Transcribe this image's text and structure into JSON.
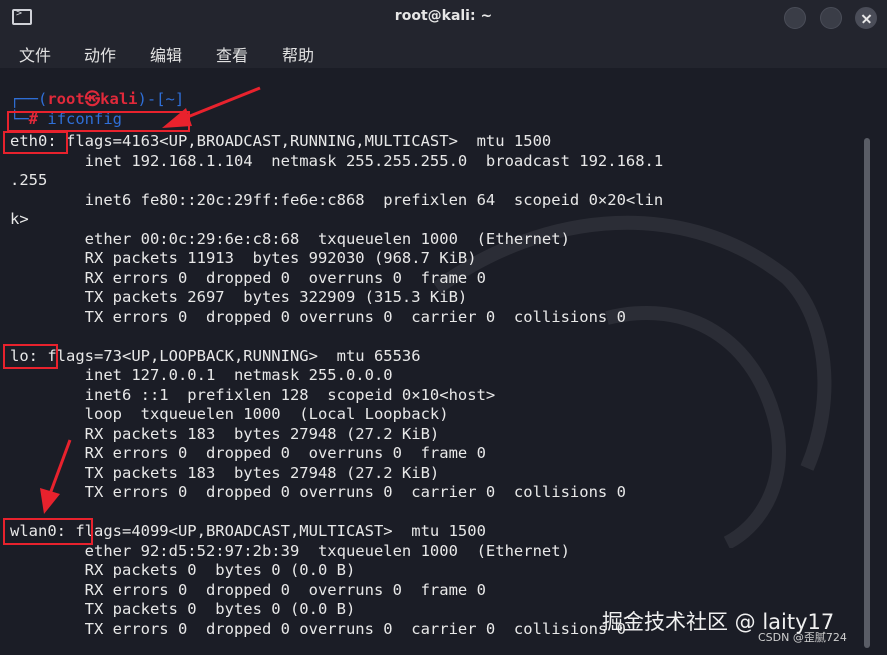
{
  "window": {
    "title": "root@kali: ~"
  },
  "menu": [
    "文件",
    "动作",
    "编辑",
    "查看",
    "帮助"
  ],
  "prompt": {
    "open": "┌──(",
    "user": "root",
    "at": "㉿",
    "host": "kali",
    "close": ")-[~]",
    "line2": "└─",
    "symbol": "#",
    "command": "ifconfig"
  },
  "output": [
    "eth0: flags=4163<UP,BROADCAST,RUNNING,MULTICAST>  mtu 1500",
    "        inet 192.168.1.104  netmask 255.255.255.0  broadcast 192.168.1",
    ".255",
    "        inet6 fe80::20c:29ff:fe6e:c868  prefixlen 64  scopeid 0×20<lin",
    "k>",
    "        ether 00:0c:29:6e:c8:68  txqueuelen 1000  (Ethernet)",
    "        RX packets 11913  bytes 992030 (968.7 KiB)",
    "        RX errors 0  dropped 0  overruns 0  frame 0",
    "        TX packets 2697  bytes 322909 (315.3 KiB)",
    "        TX errors 0  dropped 0 overruns 0  carrier 0  collisions 0",
    "",
    "lo: flags=73<UP,LOOPBACK,RUNNING>  mtu 65536",
    "        inet 127.0.0.1  netmask 255.0.0.0",
    "        inet6 ::1  prefixlen 128  scopeid 0×10<host>",
    "        loop  txqueuelen 1000  (Local Loopback)",
    "        RX packets 183  bytes 27948 (27.2 KiB)",
    "        RX errors 0  dropped 0  overruns 0  frame 0",
    "        TX packets 183  bytes 27948 (27.2 KiB)",
    "        TX errors 0  dropped 0 overruns 0  carrier 0  collisions 0",
    "",
    "wlan0: flags=4099<UP,BROADCAST,MULTICAST>  mtu 1500",
    "        ether 92:d5:52:97:2b:39  txqueuelen 1000  (Ethernet)",
    "        RX packets 0  bytes 0 (0.0 B)",
    "        RX errors 0  dropped 0  overruns 0  frame 0",
    "        TX packets 0  bytes 0 (0.0 B)",
    "        TX errors 0  dropped 0 overruns 0  carrier 0  collisions 0"
  ],
  "watermark": "掘金技术社区 @ laity17",
  "csdn": "CSDN @歪腻724",
  "colors": {
    "background": "#1b1d26",
    "prompt_user": "#e0293a",
    "prompt_frame": "#2f6fd8",
    "annotation": "#e8222d"
  }
}
